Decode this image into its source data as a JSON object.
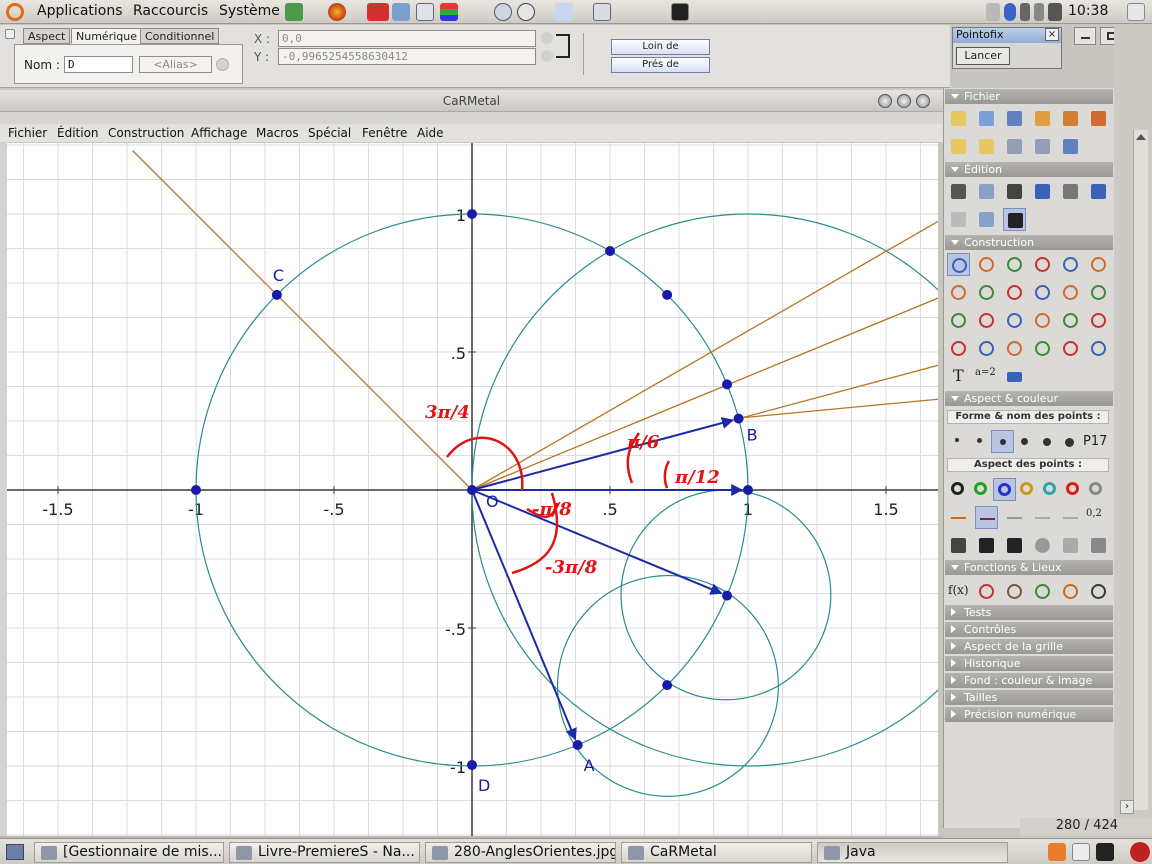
{
  "top_panel": {
    "menus": [
      "Applications",
      "Raccourcis",
      "Système"
    ],
    "clock": "10:38"
  },
  "inspector": {
    "tabs": [
      "Aspect",
      "Numérique",
      "Conditionnel"
    ],
    "name_label": "Nom :",
    "name_value": "D",
    "alias_placeholder": "<Alias>",
    "x_label": "X :",
    "x_value": "0,0",
    "y_label": "Y :",
    "y_value": "-0,9965254558630412",
    "far_button": "Loin de",
    "near_button": "Prés de"
  },
  "pointofix": {
    "title": "Pointofix",
    "close": "×",
    "launch_button": "Lancer"
  },
  "carmetal": {
    "title": "CaRMetal",
    "menu": [
      "Fichier",
      "Édition",
      "Construction",
      "Affichage",
      "Macros",
      "Spécial",
      "Fenêtre",
      "Aide"
    ]
  },
  "chart_data": {
    "type": "geometry",
    "x_ticks": [
      "-1.5",
      "-1",
      "-.5",
      ".5",
      "1",
      "1.5"
    ],
    "y_ticks": [
      "1",
      ".5",
      "-.5",
      "-1"
    ],
    "xlim": [
      -1.68,
      1.7
    ],
    "ylim": [
      -1.26,
      1.26
    ],
    "grid": true,
    "origin_label": "O",
    "points": [
      {
        "label": "C",
        "x": -0.707,
        "y": 0.707
      },
      {
        "label": "B",
        "x": 0.9659,
        "y": 0.2588
      },
      {
        "label": "A",
        "x": 0.3827,
        "y": -0.9239
      },
      {
        "label": "D",
        "x": 0.0,
        "y": -0.9965
      }
    ],
    "annotations": [
      "3π/4",
      "π/6",
      "π/12",
      "-π/8",
      "-3π/8"
    ],
    "colors": {
      "axes": "#3a3a3a",
      "grid": "#dcdcdc",
      "circle": "#2a8c8c",
      "line": "#b8741e",
      "vector": "#1c2aa6",
      "point": "#1a1aa8",
      "ink": "#e01414"
    }
  },
  "palette": {
    "sections": [
      "Fichier",
      "Édition",
      "Construction",
      "Aspect & couleur",
      "Fonctions & Lieux",
      "Tests",
      "Contrôles",
      "Aspect de la grille",
      "Historique",
      "Fond : couleur & image",
      "Tailles",
      "Précision numérique"
    ],
    "forme_label": "Forme & nom des points :",
    "aspect_points_label": "Aspect des points :",
    "p17": "P17",
    "swatch_colors": [
      "#222222",
      "#22a022",
      "#2233cc",
      "#c89a1e",
      "#2aa6a6",
      "#d62020",
      "#888888"
    ],
    "text_tool": "T",
    "fx_tool": "f(x)",
    "a2_tool": "a=2",
    "decimal_tool": "0,2"
  },
  "statusbar": {
    "page_count": "280 / 424"
  },
  "taskbar": [
    "[Gestionnaire de mis...",
    "Livre-PremiereS - Na...",
    "280-AnglesOrientes.jpg",
    "CaRMetal",
    "Java"
  ]
}
